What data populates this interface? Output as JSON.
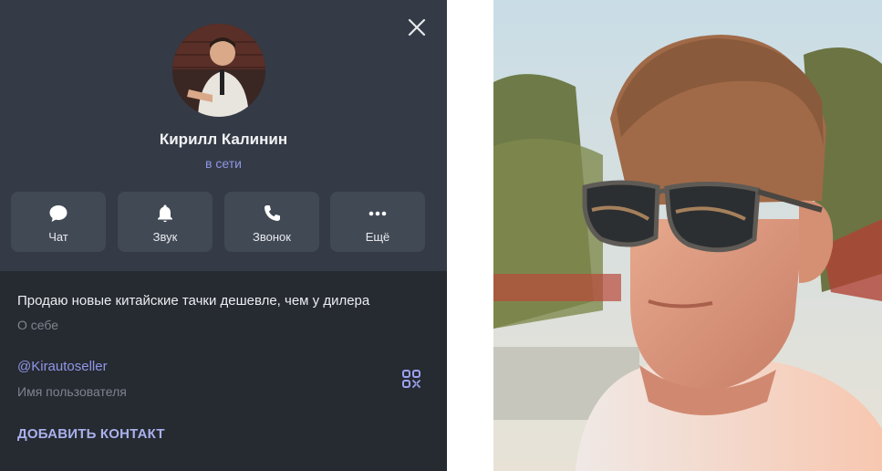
{
  "profile": {
    "name": "Кирилл Калинин",
    "status": "в сети"
  },
  "actions": [
    {
      "label": "Чат",
      "icon": "chat-bubble-icon"
    },
    {
      "label": "Звук",
      "icon": "bell-icon"
    },
    {
      "label": "Звонок",
      "icon": "phone-icon"
    },
    {
      "label": "Ещё",
      "icon": "more-dots-icon"
    }
  ],
  "info": {
    "about_text": "Продаю новые китайские тачки дешевле, чем у дилера",
    "about_label": "О себе",
    "username": "@Kirautoseller",
    "username_label": "Имя пользователя",
    "add_contact": "ДОБАВИТЬ КОНТАКТ"
  },
  "colors": {
    "panel_bg": "#343b46",
    "info_bg": "#262a31",
    "accent": "#8f96e6",
    "button_bg": "#414955"
  }
}
